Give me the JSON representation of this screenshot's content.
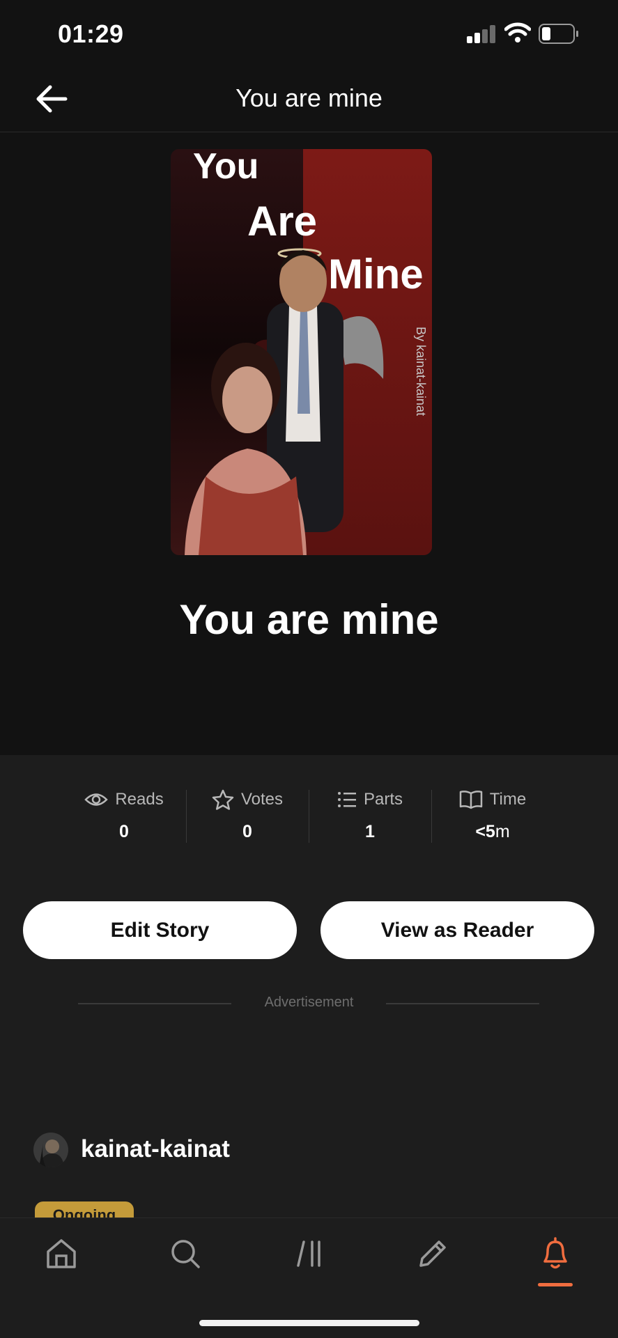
{
  "status_bar": {
    "time": "01:29"
  },
  "header": {
    "title": "You are mine"
  },
  "cover": {
    "title_line1": "You",
    "title_line2": "Are",
    "title_line3": "Mine",
    "byline": "By kainat-kainat"
  },
  "story": {
    "title": "You are mine"
  },
  "stats": [
    {
      "label": "Reads",
      "value": "0",
      "icon": "eye-icon"
    },
    {
      "label": "Votes",
      "value": "0",
      "icon": "star-icon"
    },
    {
      "label": "Parts",
      "value": "1",
      "icon": "list-icon"
    },
    {
      "label": "Time",
      "value_bold": "<5",
      "value_unit": "m",
      "icon": "book-icon"
    }
  ],
  "actions": {
    "edit_label": "Edit Story",
    "view_label": "View as Reader"
  },
  "ad": {
    "label": "Advertisement"
  },
  "author": {
    "name": "kainat-kainat"
  },
  "badge": {
    "label": "Ongoing"
  },
  "nav": {
    "items": [
      "home-icon",
      "search-icon",
      "library-icon",
      "write-icon",
      "notifications-icon"
    ],
    "active": "notifications-icon"
  },
  "colors": {
    "background": "#121212",
    "panel": "#1d1d1d",
    "accent": "#f06d3f",
    "badge": "#c49b3a"
  }
}
